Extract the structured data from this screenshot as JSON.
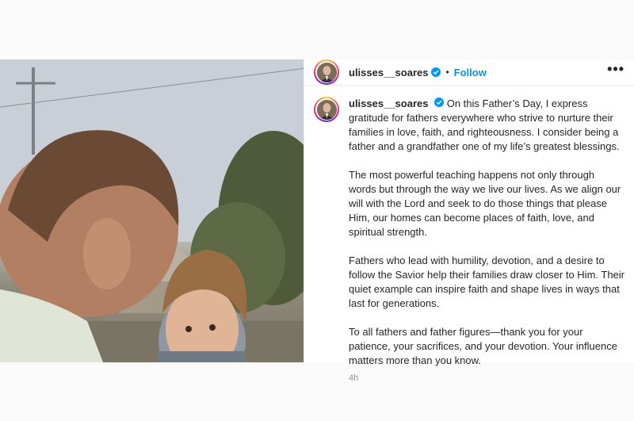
{
  "post": {
    "username": "ulisses__soares",
    "separator": "•",
    "follow_label": "Follow",
    "more_label": "•••",
    "caption_paragraphs": [
      "On this Father’s Day, I express gratitude for fathers everywhere who strive to nurture their families in love, faith, and righteousness. I consider being a father and a grandfather one of my life’s greatest blessings.",
      "The most powerful teaching happens not only through words but through the way we live our lives. As we align our will with the Lord and seek to do those things that please Him, our homes can become places of faith, love, and spiritual strength.",
      "Fathers who lead with humility, devotion, and a desire to follow the Savior help their families draw closer to Him. Their quiet example can inspire faith and shape lives in ways that last for generations.",
      "To all fathers and father figures—thank you for your patience, your sacrifices, and your devotion. Your influence matters more than you know."
    ],
    "timestamp": "4h"
  },
  "colors": {
    "accent": "#0095f6",
    "verified": "#0095f6",
    "muted": "#8e8e8e"
  }
}
